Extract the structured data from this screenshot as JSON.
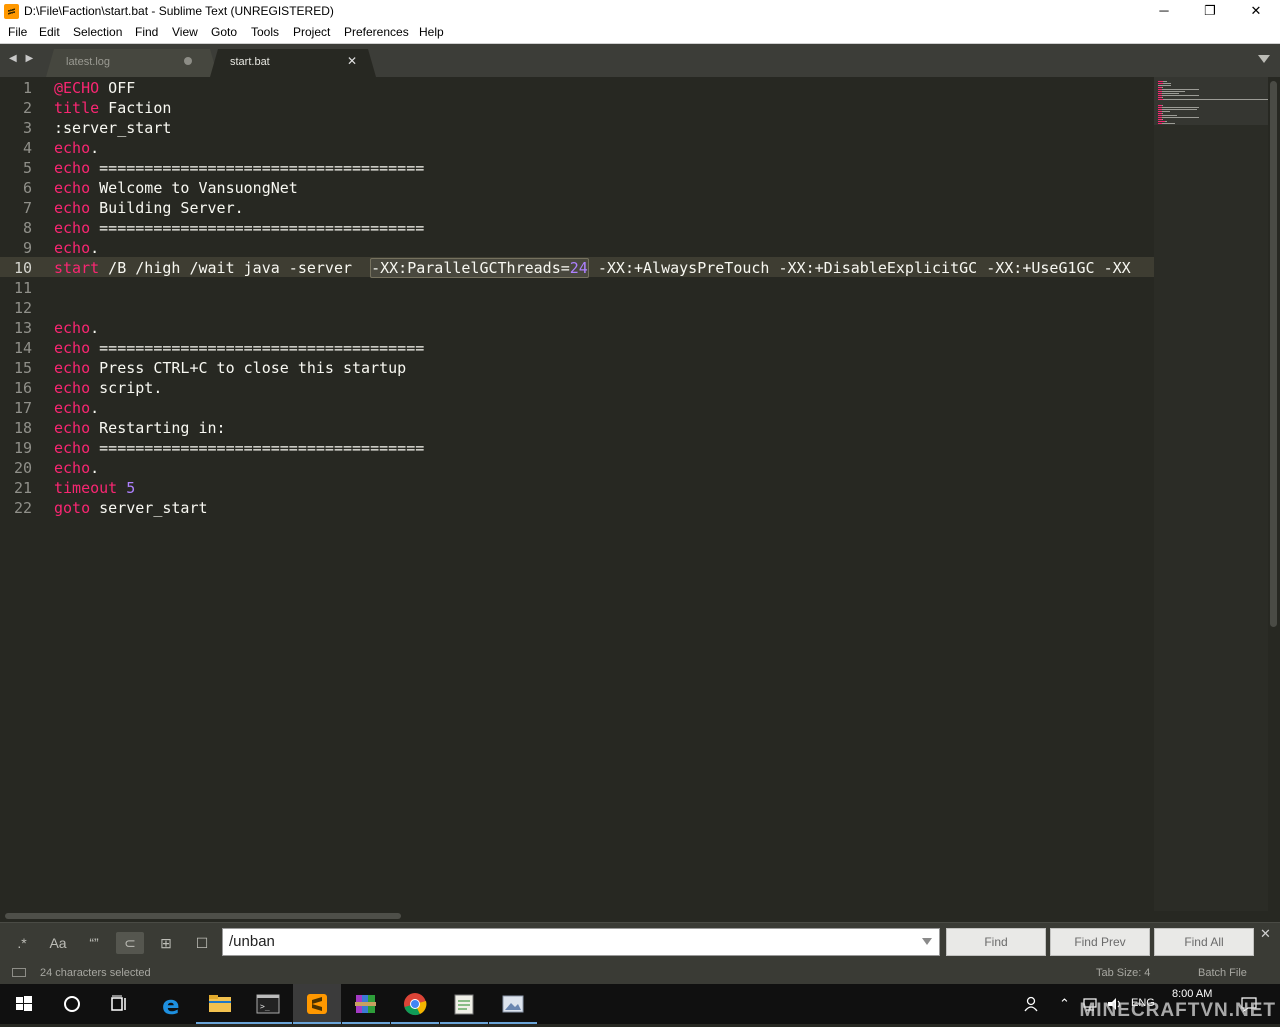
{
  "window": {
    "title": "D:\\File\\Faction\\start.bat - Sublime Text (UNREGISTERED)",
    "minimize": "─",
    "restore": "❐",
    "close": "✕"
  },
  "menu": [
    "File",
    "Edit",
    "Selection",
    "Find",
    "View",
    "Goto",
    "Tools",
    "Project",
    "Preferences",
    "Help"
  ],
  "tabs": {
    "nav": "◀ ▶",
    "inactive": {
      "label": "latest.log"
    },
    "active": {
      "label": "start.bat",
      "close": "✕"
    }
  },
  "editor": {
    "line_numbers": [
      "1",
      "2",
      "3",
      "4",
      "5",
      "6",
      "7",
      "8",
      "9",
      "10",
      "11",
      "12",
      "13",
      "14",
      "15",
      "16",
      "17",
      "18",
      "19",
      "20",
      "21",
      "22"
    ],
    "current_line": "10",
    "lines": [
      {
        "kw": "@ECHO",
        "rest": " OFF"
      },
      {
        "kw": "title",
        "rest": " Faction"
      },
      {
        "kw": "",
        "rest": ":server_start"
      },
      {
        "kw": "echo",
        "rest": "."
      },
      {
        "kw": "echo",
        "rest": " ===================================="
      },
      {
        "kw": "echo",
        "rest": " Welcome to VansuongNet"
      },
      {
        "kw": "echo",
        "rest": " Building Server."
      },
      {
        "kw": "echo",
        "rest": " ===================================="
      },
      {
        "kw": "echo",
        "rest": "."
      },
      {
        "kw": "start",
        "pre": " /B /high /wait java -server  ",
        "sel_text": "-XX:ParallelGCThreads=",
        "sel_num": "24",
        "post": " -XX:+AlwaysPreTouch -XX:+DisableExplicitGC -XX:+UseG1GC -XX"
      },
      {
        "kw": "",
        "rest": ""
      },
      {
        "kw": "",
        "rest": ""
      },
      {
        "kw": "echo",
        "rest": "."
      },
      {
        "kw": "echo",
        "rest": " ===================================="
      },
      {
        "kw": "echo",
        "rest": " Press CTRL+C to close this startup"
      },
      {
        "kw": "echo",
        "rest": " script."
      },
      {
        "kw": "echo",
        "rest": "."
      },
      {
        "kw": "echo",
        "rest": " Restarting in:"
      },
      {
        "kw": "echo",
        "rest": " ===================================="
      },
      {
        "kw": "echo",
        "rest": "."
      },
      {
        "kw": "timeout",
        "num": " 5"
      },
      {
        "kw": "goto",
        "rest": " server_start"
      }
    ]
  },
  "find": {
    "options": [
      ".*",
      "Aa",
      "“”",
      "⊂",
      "⊞",
      "☐"
    ],
    "query": "/unban",
    "find_label": "Find",
    "find_prev_label": "Find Prev",
    "find_all_label": "Find All",
    "close": "✕"
  },
  "status": {
    "selection": "24 characters selected",
    "tab_size": "Tab Size: 4",
    "syntax": "Batch File"
  },
  "taskbar": {
    "tray_lang": "ENG",
    "time": "8:00 AM"
  },
  "watermark": "MINECRAFTVN.NET",
  "colors": {
    "keyword": "#f92672",
    "number": "#ae81ff",
    "text": "#f8f8f2",
    "background": "#272822"
  }
}
